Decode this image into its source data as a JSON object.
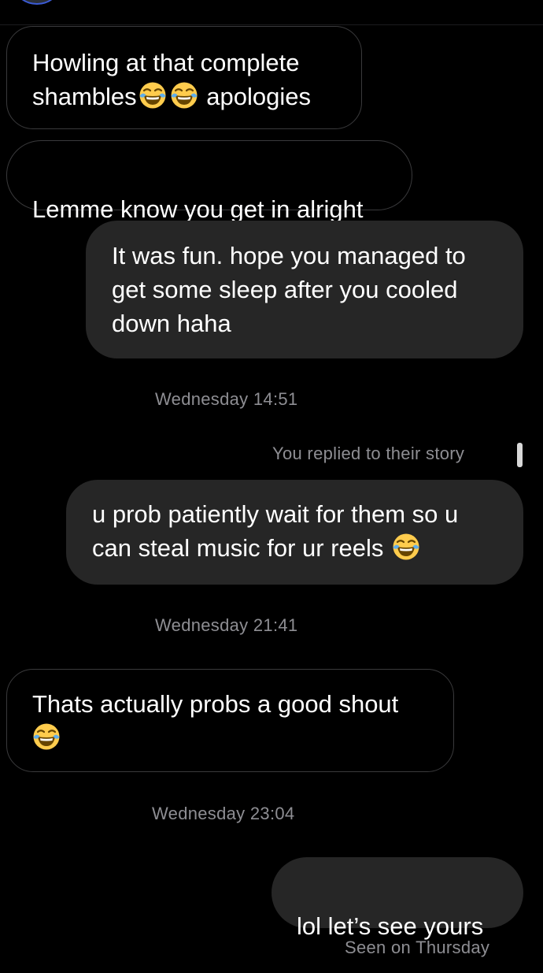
{
  "messages": {
    "m1": {
      "part1": "Howling at that complete\nshambles",
      "part2": " apologies",
      "emoji": "face-with-tears-of-joy"
    },
    "m2": {
      "text": "Lemme know you get in alright"
    },
    "m3": {
      "text": "It was fun. hope you managed to\nget some sleep after you cooled\ndown haha"
    },
    "ts1": "Wednesday 14:51",
    "story_reply_label": "You replied to their story",
    "m4": {
      "text": "u prob patiently wait for them so u\ncan steal music for ur reels",
      "emoji": "face-with-tears-of-joy"
    },
    "ts2": "Wednesday 21:41",
    "m5": {
      "text": "Thats actually probs a good shout",
      "emoji": "face-with-tears-of-joy"
    },
    "ts3": "Wednesday 23:04",
    "m6": {
      "text": "lol let’s see yours"
    },
    "seen": "Seen on Thursday"
  },
  "colors": {
    "background": "#000000",
    "sent_bubble": "#262626",
    "received_border": "#3a3a3c",
    "meta_text": "#8e8e93"
  }
}
